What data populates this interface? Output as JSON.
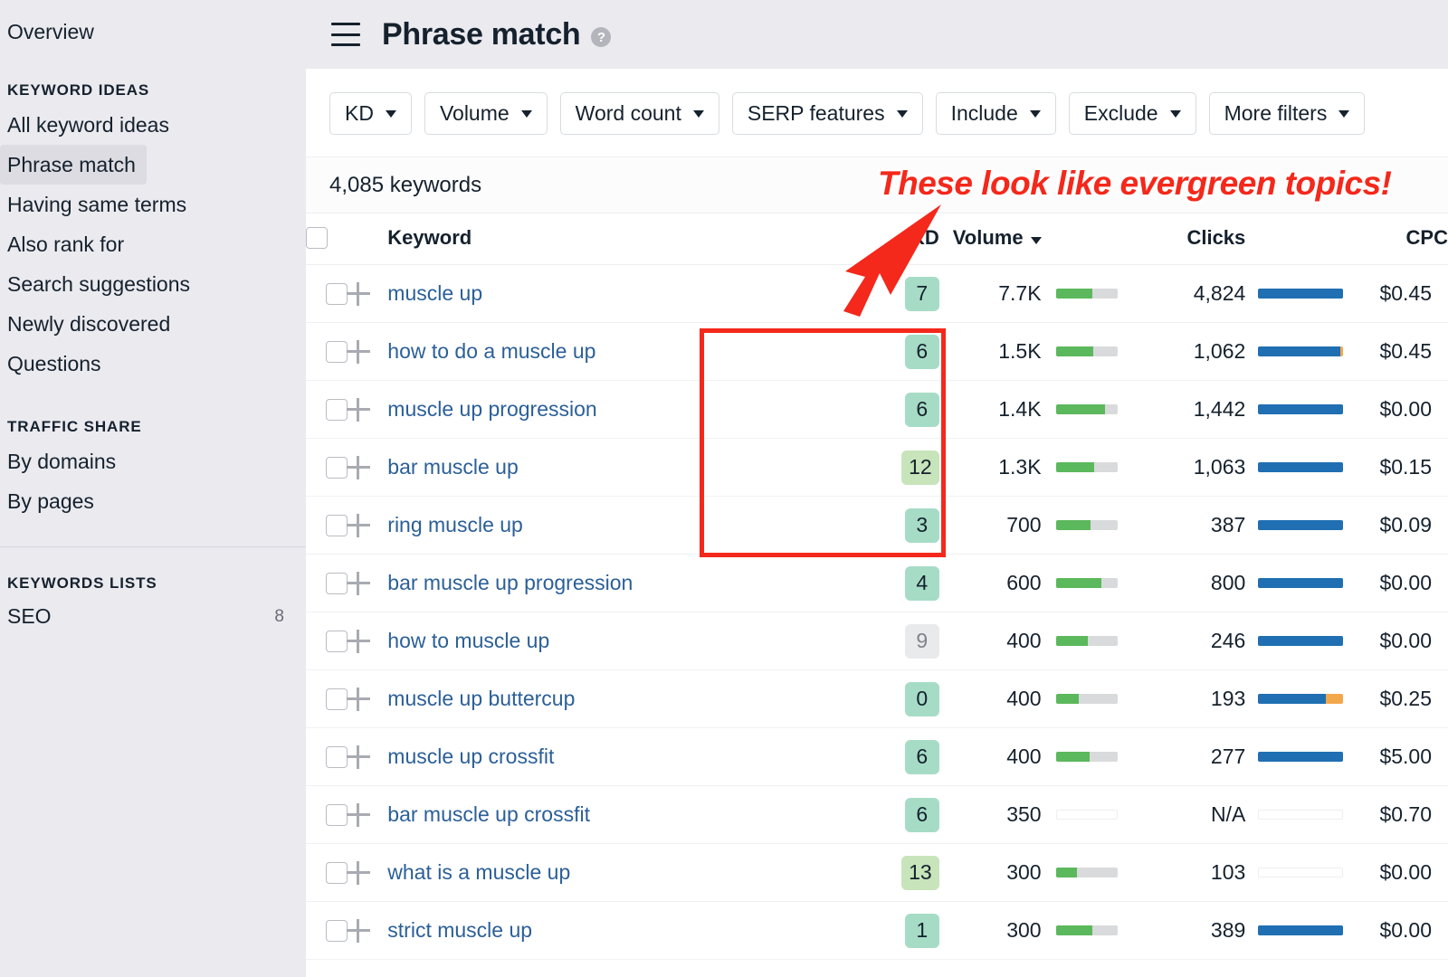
{
  "sidebar": {
    "overview": "Overview",
    "sections": [
      {
        "heading": "KEYWORD IDEAS",
        "items": [
          {
            "label": "All keyword ideas",
            "active": false
          },
          {
            "label": "Phrase match",
            "active": true
          },
          {
            "label": "Having same terms",
            "active": false
          },
          {
            "label": "Also rank for",
            "active": false
          },
          {
            "label": "Search suggestions",
            "active": false
          },
          {
            "label": "Newly discovered",
            "active": false
          },
          {
            "label": "Questions",
            "active": false
          }
        ]
      },
      {
        "heading": "TRAFFIC SHARE",
        "items": [
          {
            "label": "By domains",
            "active": false
          },
          {
            "label": "By pages",
            "active": false
          }
        ]
      }
    ],
    "lists_heading": "KEYWORDS LISTS",
    "lists": [
      {
        "name": "SEO",
        "count": "8"
      }
    ]
  },
  "header": {
    "menu_icon": "hamburger-icon",
    "title": "Phrase match",
    "help_icon": "?"
  },
  "filters": [
    {
      "label": "KD"
    },
    {
      "label": "Volume"
    },
    {
      "label": "Word count"
    },
    {
      "label": "SERP features"
    },
    {
      "label": "Include"
    },
    {
      "label": "Exclude"
    },
    {
      "label": "More filters"
    }
  ],
  "results": {
    "count_label": "4,085 keywords"
  },
  "table": {
    "columns": {
      "keyword": "Keyword",
      "kd": "KD",
      "volume": "Volume",
      "clicks": "Clicks",
      "cpc": "CPC"
    },
    "sorted_column": "Volume",
    "sort_direction": "desc",
    "rows": [
      {
        "keyword": "muscle up",
        "kd": "7",
        "kd_style": "kd-green",
        "volume": "7.7K",
        "volume_pct": 60,
        "clicks": "4,824",
        "clicks_blue_pct": 100,
        "clicks_orange_pct": 0,
        "cpc": "$0.45"
      },
      {
        "keyword": "how to do a muscle up",
        "kd": "6",
        "kd_style": "kd-green",
        "volume": "1.5K",
        "volume_pct": 61,
        "clicks": "1,062",
        "clicks_blue_pct": 97,
        "clicks_orange_pct": 3,
        "cpc": "$0.45"
      },
      {
        "keyword": "muscle up progression",
        "kd": "6",
        "kd_style": "kd-green",
        "volume": "1.4K",
        "volume_pct": 80,
        "clicks": "1,442",
        "clicks_blue_pct": 100,
        "clicks_orange_pct": 0,
        "cpc": "$0.00"
      },
      {
        "keyword": "bar muscle up",
        "kd": "12",
        "kd_style": "kd-lgreen",
        "volume": "1.3K",
        "volume_pct": 63,
        "clicks": "1,063",
        "clicks_blue_pct": 100,
        "clicks_orange_pct": 0,
        "cpc": "$0.15"
      },
      {
        "keyword": "ring muscle up",
        "kd": "3",
        "kd_style": "kd-green",
        "volume": "700",
        "volume_pct": 56,
        "clicks": "387",
        "clicks_blue_pct": 100,
        "clicks_orange_pct": 0,
        "cpc": "$0.09"
      },
      {
        "keyword": "bar muscle up progression",
        "kd": "4",
        "kd_style": "kd-green",
        "volume": "600",
        "volume_pct": 74,
        "clicks": "800",
        "clicks_blue_pct": 100,
        "clicks_orange_pct": 0,
        "cpc": "$0.00"
      },
      {
        "keyword": "how to muscle up",
        "kd": "9",
        "kd_style": "kd-gray",
        "volume": "400",
        "volume_pct": 52,
        "clicks": "246",
        "clicks_blue_pct": 100,
        "clicks_orange_pct": 0,
        "cpc": "$0.00"
      },
      {
        "keyword": "muscle up buttercup",
        "kd": "0",
        "kd_style": "kd-green",
        "volume": "400",
        "volume_pct": 38,
        "clicks": "193",
        "clicks_blue_pct": 79,
        "clicks_orange_pct": 21,
        "cpc": "$0.25"
      },
      {
        "keyword": "muscle up crossfit",
        "kd": "6",
        "kd_style": "kd-green",
        "volume": "400",
        "volume_pct": 55,
        "clicks": "277",
        "clicks_blue_pct": 100,
        "clicks_orange_pct": 0,
        "cpc": "$5.00"
      },
      {
        "keyword": "bar muscle up crossfit",
        "kd": "6",
        "kd_style": "kd-green",
        "volume": "350",
        "volume_pct": 0,
        "clicks": "N/A",
        "clicks_blue_pct": 0,
        "clicks_orange_pct": 0,
        "cpc": "$0.70"
      },
      {
        "keyword": "what is a muscle up",
        "kd": "13",
        "kd_style": "kd-lgreen",
        "volume": "300",
        "volume_pct": 34,
        "clicks": "103",
        "clicks_blue_pct": 0,
        "clicks_orange_pct": 0,
        "cpc": "$0.00"
      },
      {
        "keyword": "strict muscle up",
        "kd": "1",
        "kd_style": "kd-green",
        "volume": "300",
        "volume_pct": 60,
        "clicks": "389",
        "clicks_blue_pct": 100,
        "clicks_orange_pct": 0,
        "cpc": "$0.00"
      }
    ]
  },
  "annotations": {
    "callout_text": "These look like evergreen topics!",
    "callout_color": "#f4281b",
    "highlight_box_color": "#f4281b",
    "arrow_icon": "red-arrow-icon"
  }
}
